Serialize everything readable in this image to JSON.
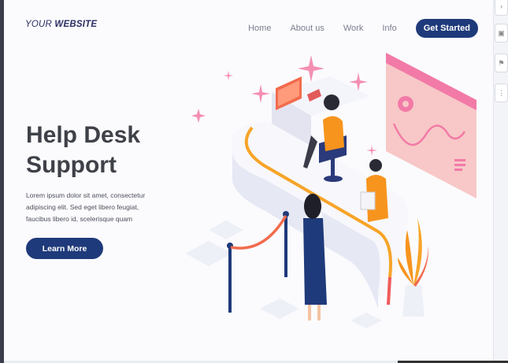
{
  "brand": {
    "part1": "YOUR ",
    "part2": "WEBSITE"
  },
  "nav": {
    "items": [
      {
        "label": "Home"
      },
      {
        "label": "About us"
      },
      {
        "label": "Work"
      },
      {
        "label": "Info"
      }
    ],
    "cta_label": "Get Started"
  },
  "hero": {
    "title_line1": "Help Desk",
    "title_line2": "Support",
    "body": "Lorem ipsum dolor sit amet, consectetur adipiscing elit. Sed eget libero feugiat, faucibus libero id, scelerisque quam",
    "button_label": "Learn More"
  },
  "colors": {
    "primary": "#1f3a7a",
    "title": "#3f4148",
    "accent_orange": "#f7941d",
    "accent_pink": "#f48fb1"
  },
  "icons": [
    "chevron-icon",
    "image-icon",
    "flag-icon",
    "more-icon"
  ]
}
